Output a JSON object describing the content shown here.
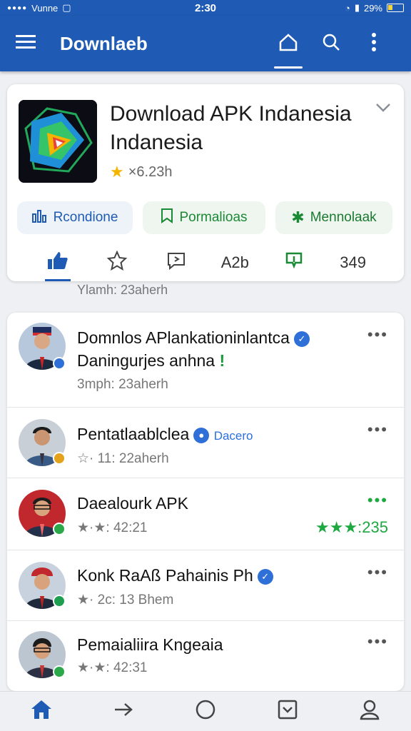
{
  "status_bar": {
    "carrier": "Vunne",
    "time": "2:30",
    "battery": "29%"
  },
  "app_bar": {
    "title": "Downlaeb",
    "icons": [
      "menu-icon",
      "home-icon",
      "search-icon",
      "more-vertical-icon"
    ]
  },
  "app_card": {
    "name": "Download APK Indanesia Indanesia",
    "rating_text": "×6.23h",
    "chips": [
      {
        "label": "Rcondione",
        "icon": "stats-icon"
      },
      {
        "label": "Pormalioas",
        "icon": "save-icon"
      },
      {
        "label": "Mennolaak",
        "icon": "star-icon"
      }
    ],
    "actions": [
      {
        "icon": "thumbs-up-icon"
      },
      {
        "icon": "star-outline-icon"
      },
      {
        "icon": "comment-icon"
      },
      {
        "label": "A2b"
      },
      {
        "icon": "pin-icon"
      },
      {
        "label": "349"
      }
    ]
  },
  "meta_line": "Ylamh: 23aherh",
  "list": [
    {
      "title_line1": "Domnlos APlankationinlantca",
      "title_line2": "Daningurjes anhna",
      "title_line2_mark": "!",
      "subtitle": "3mph: 23aherh",
      "badge_color": "#2f6fd8"
    },
    {
      "title": "Pentatlaablclea",
      "tag": "Dacero",
      "subtitle": "☆· 11: 22aherh",
      "badge_color": "#e3a21a"
    },
    {
      "title": "Daealourk APK",
      "subtitle": "★·★: 42:21",
      "right_stars": "★★★:235",
      "badge_color": "#2aa84a"
    },
    {
      "title": "Konk RaAß Pahainis Ph",
      "subtitle": "★· 2c: 13 Bhem",
      "badge_color": "#1e9e50"
    },
    {
      "title": "Pemaialiira Kngeaia",
      "subtitle": "★·★: 42:31",
      "badge_color": "#2aa84a"
    }
  ],
  "bottom_nav": [
    "home-icon",
    "arrow-right-icon",
    "circle-icon",
    "inbox-icon",
    "profile-icon"
  ],
  "colors": {
    "primary": "#1f5bb4",
    "accent_green": "#1a8a36",
    "star": "#f5b400"
  }
}
